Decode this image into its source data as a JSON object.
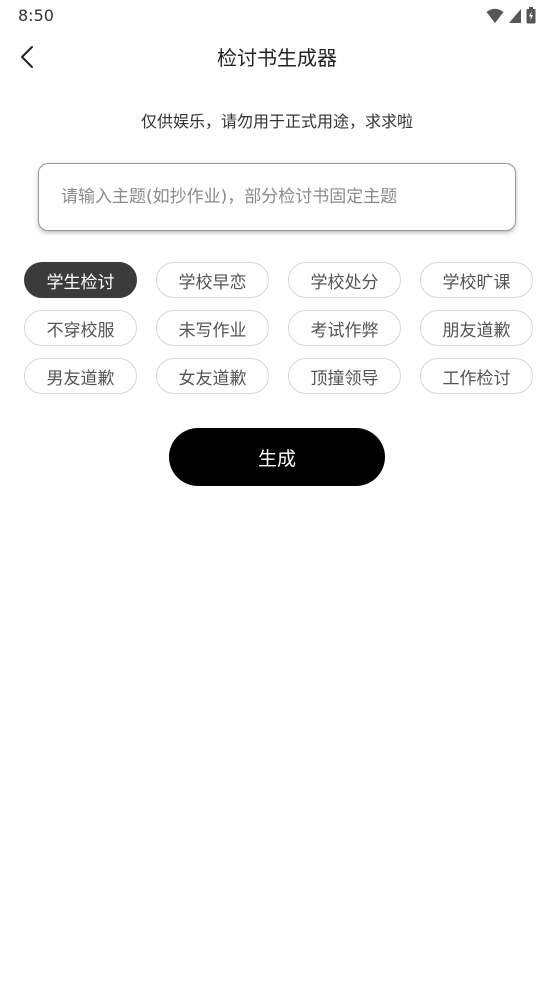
{
  "status_bar": {
    "time": "8:50"
  },
  "header": {
    "title": "检讨书生成器",
    "back_icon": "chevron-left-icon"
  },
  "subtitle": "仅供娱乐，请勿用于正式用途，求求啦",
  "topic_input": {
    "value": "",
    "placeholder": "请输入主题(如抄作业)，部分检讨书固定主题"
  },
  "topics": [
    {
      "label": "学生检讨",
      "selected": true
    },
    {
      "label": "学校早恋",
      "selected": false
    },
    {
      "label": "学校处分",
      "selected": false
    },
    {
      "label": "学校旷课",
      "selected": false
    },
    {
      "label": "不穿校服",
      "selected": false
    },
    {
      "label": "未写作业",
      "selected": false
    },
    {
      "label": "考试作弊",
      "selected": false
    },
    {
      "label": "朋友道歉",
      "selected": false
    },
    {
      "label": "男友道歉",
      "selected": false
    },
    {
      "label": "女友道歉",
      "selected": false
    },
    {
      "label": "顶撞领导",
      "selected": false
    },
    {
      "label": "工作检讨",
      "selected": false
    }
  ],
  "generate_button": {
    "label": "生成"
  },
  "colors": {
    "selected_chip_bg": "#3b3b3b",
    "button_bg": "#000000",
    "chip_border": "#d6d6d6"
  }
}
